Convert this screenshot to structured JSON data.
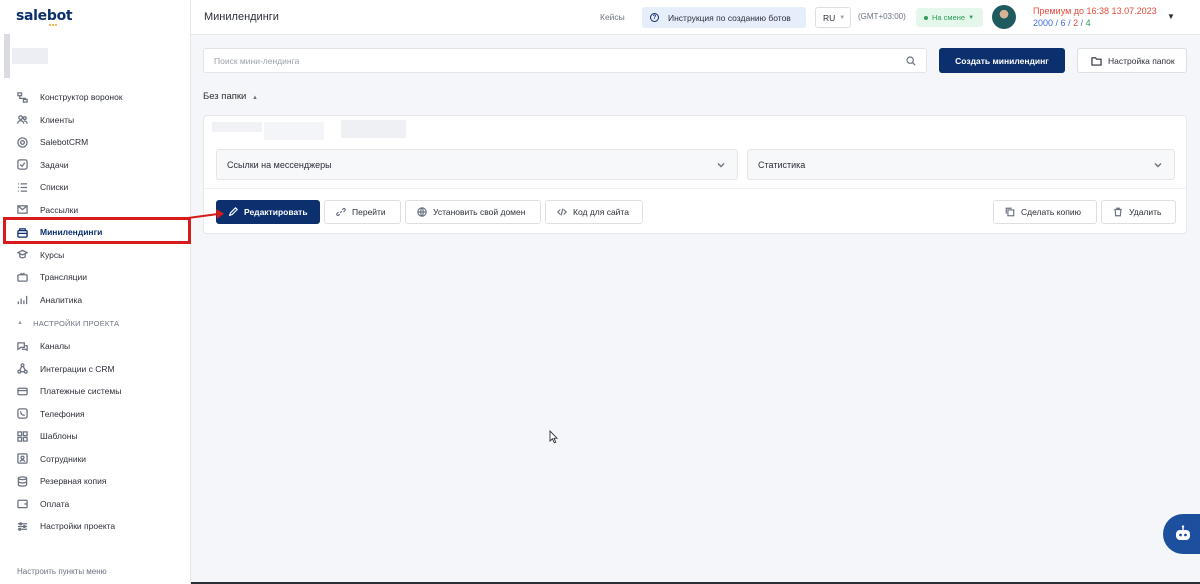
{
  "brand": {
    "logo_text": "salebot",
    "accent": "#0c2f6d",
    "highlight": "#d61b1b"
  },
  "sidebar": {
    "items": [
      {
        "label": "Конструктор воронок",
        "icon": "funnel-icon"
      },
      {
        "label": "Клиенты",
        "icon": "users-icon"
      },
      {
        "label": "SalebotCRM",
        "icon": "crm-icon"
      },
      {
        "label": "Задачи",
        "icon": "tasks-icon"
      },
      {
        "label": "Списки",
        "icon": "list-icon"
      },
      {
        "label": "Рассылки",
        "icon": "mail-icon"
      },
      {
        "label": "Минилендинги",
        "icon": "landing-icon",
        "active": true
      },
      {
        "label": "Курсы",
        "icon": "courses-icon"
      },
      {
        "label": "Трансляции",
        "icon": "broadcast-icon"
      },
      {
        "label": "Аналитика",
        "icon": "chart-icon"
      }
    ],
    "section_title": "НАСТРОЙКИ ПРОЕКТА",
    "settings_items": [
      {
        "label": "Каналы",
        "icon": "channels-icon"
      },
      {
        "label": "Интеграции с CRM",
        "icon": "integrations-icon"
      },
      {
        "label": "Платежные системы",
        "icon": "payment-icon"
      },
      {
        "label": "Телефония",
        "icon": "phone-icon"
      },
      {
        "label": "Шаблоны",
        "icon": "templates-icon"
      },
      {
        "label": "Сотрудники",
        "icon": "staff-icon"
      },
      {
        "label": "Резервная копия",
        "icon": "backup-icon"
      },
      {
        "label": "Оплата",
        "icon": "wallet-icon"
      },
      {
        "label": "Настройки проекта",
        "icon": "settings-icon"
      }
    ],
    "footer_link": "Настроить пункты меню"
  },
  "header": {
    "title": "Минилендинги",
    "cases": "Кейсы",
    "instruction": "Инструкция по созданию ботов",
    "lang": "RU",
    "timezone": "(GMT+03:00)",
    "shift_status": "На смене",
    "premium": "Премиум до 16:38 13.07.2023",
    "quota": {
      "a": "2000",
      "b": "6",
      "c": "2",
      "d": "4"
    }
  },
  "main": {
    "search_placeholder": "Поиск мини-лендинга",
    "create_button": "Создать минилендинг",
    "folders_button": "Настройка папок",
    "folder_label": "Без папки",
    "card": {
      "dropdown_links": "Ссылки на мессенджеры",
      "dropdown_stats": "Статистика",
      "edit": "Редактировать",
      "open": "Перейти",
      "domain": "Установить свой домен",
      "code": "Код для сайта",
      "copy": "Сделать копию",
      "delete": "Удалить"
    }
  }
}
